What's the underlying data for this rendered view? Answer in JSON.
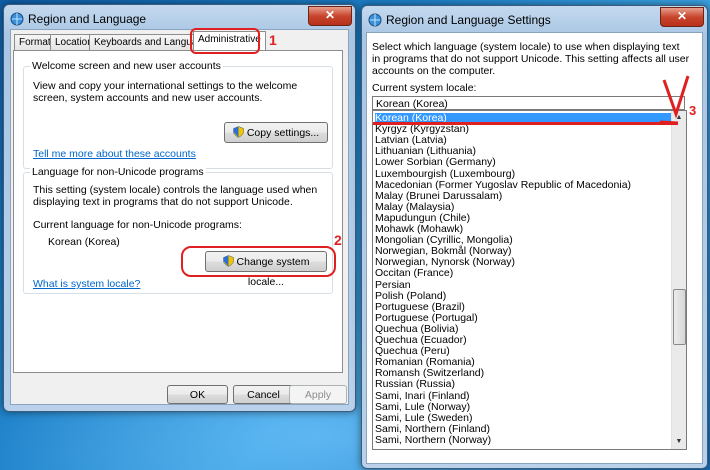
{
  "left_window": {
    "title": "Region and Language",
    "close_label": "✕",
    "tabs": [
      {
        "label": "Formats"
      },
      {
        "label": "Location"
      },
      {
        "label": "Keyboards and Languages"
      },
      {
        "label": "Administrative"
      }
    ],
    "welcome_group": {
      "title": "Welcome screen and new user accounts",
      "description": "View and copy your international settings to the welcome screen, system accounts and new user accounts.",
      "copy_button": "Copy settings...",
      "link": "Tell me more about these accounts"
    },
    "nonunicode_group": {
      "title": "Language for non-Unicode programs",
      "description": "This setting (system locale) controls the language used when displaying text in programs that do not support Unicode.",
      "current_label": "Current language for non-Unicode programs:",
      "current_value": "Korean (Korea)",
      "change_button": "Change system locale...",
      "link": "What is system locale?"
    },
    "buttons": {
      "ok": "OK",
      "cancel": "Cancel",
      "apply": "Apply"
    }
  },
  "right_window": {
    "title": "Region and Language Settings",
    "close_label": "✕",
    "description": "Select which language (system locale) to use when displaying text in programs that do not support Unicode. This setting affects all user accounts on the computer.",
    "current_label": "Current system locale:",
    "combo_value": "Korean (Korea)",
    "list_items": [
      "Korean (Korea)",
      "Kyrgyz (Kyrgyzstan)",
      "Latvian (Latvia)",
      "Lithuanian (Lithuania)",
      "Lower Sorbian (Germany)",
      "Luxembourgish (Luxembourg)",
      "Macedonian (Former Yugoslav Republic of Macedonia)",
      "Malay (Brunei Darussalam)",
      "Malay (Malaysia)",
      "Mapudungun (Chile)",
      "Mohawk (Mohawk)",
      "Mongolian (Cyrillic, Mongolia)",
      "Norwegian, Bokmål (Norway)",
      "Norwegian, Nynorsk (Norway)",
      "Occitan (France)",
      "Persian",
      "Polish (Poland)",
      "Portuguese (Brazil)",
      "Portuguese (Portugal)",
      "Quechua (Bolivia)",
      "Quechua (Ecuador)",
      "Quechua (Peru)",
      "Romanian (Romania)",
      "Romansh (Switzerland)",
      "Russian (Russia)",
      "Sami, Inari (Finland)",
      "Sami, Lule (Norway)",
      "Sami, Lule (Sweden)",
      "Sami, Northern (Finland)",
      "Sami, Northern (Norway)"
    ],
    "selected_index": 0
  },
  "annotations": [
    "1",
    "2",
    "3"
  ],
  "colors": {
    "annotation": "#e02020",
    "selection": "#3399ff",
    "link": "#0066cc"
  }
}
